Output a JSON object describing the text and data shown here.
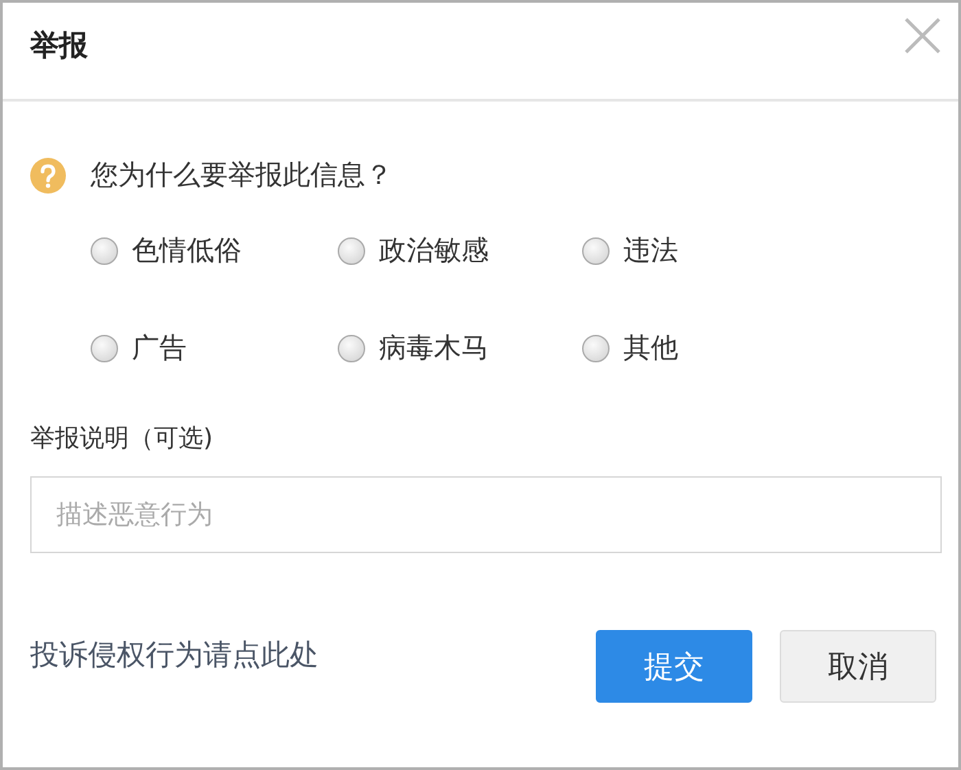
{
  "dialog": {
    "title": "举报"
  },
  "question": "您为什么要举报此信息？",
  "reasons": [
    {
      "label": "色情低俗",
      "selected": false
    },
    {
      "label": "政治敏感",
      "selected": false
    },
    {
      "label": "违法",
      "selected": false
    },
    {
      "label": "广告",
      "selected": false
    },
    {
      "label": "病毒木马",
      "selected": false
    },
    {
      "label": "其他",
      "selected": false
    }
  ],
  "description": {
    "label": "举报说明（可选)",
    "placeholder": "描述恶意行为"
  },
  "infringement_link": "投诉侵权行为请点此处",
  "buttons": [
    {
      "label": "提交",
      "kind": "primary"
    },
    {
      "label": "取消",
      "kind": "secondary"
    }
  ]
}
